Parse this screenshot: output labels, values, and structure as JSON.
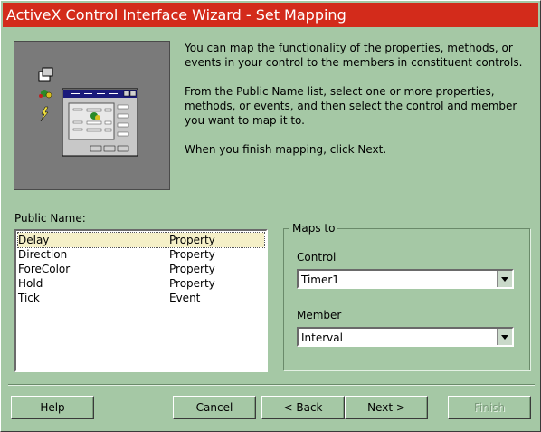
{
  "window": {
    "title": "ActiveX Control Interface Wizard - Set Mapping"
  },
  "description": {
    "p1": "You can map the functionality of the properties, methods, or events in your control to the members in constituent controls.",
    "p2": "From the Public Name list, select one or more properties, methods, or events, and then select the control and member you want to map it to.",
    "p3": "When you finish mapping, click Next."
  },
  "public_names": {
    "label": "Public Name:",
    "rows": [
      {
        "name": "Delay",
        "type": "Property",
        "selected": true
      },
      {
        "name": "Direction",
        "type": "Property"
      },
      {
        "name": "ForeColor",
        "type": "Property"
      },
      {
        "name": "Hold",
        "type": "Property"
      },
      {
        "name": "Tick",
        "type": "Event"
      }
    ]
  },
  "maps_to": {
    "legend": "Maps to",
    "control_label": "Control",
    "control_value": "Timer1",
    "member_label": "Member",
    "member_value": "Interval"
  },
  "buttons": {
    "help": "Help",
    "cancel": "Cancel",
    "back": "< Back",
    "next": "Next >",
    "finish": "Finish"
  }
}
